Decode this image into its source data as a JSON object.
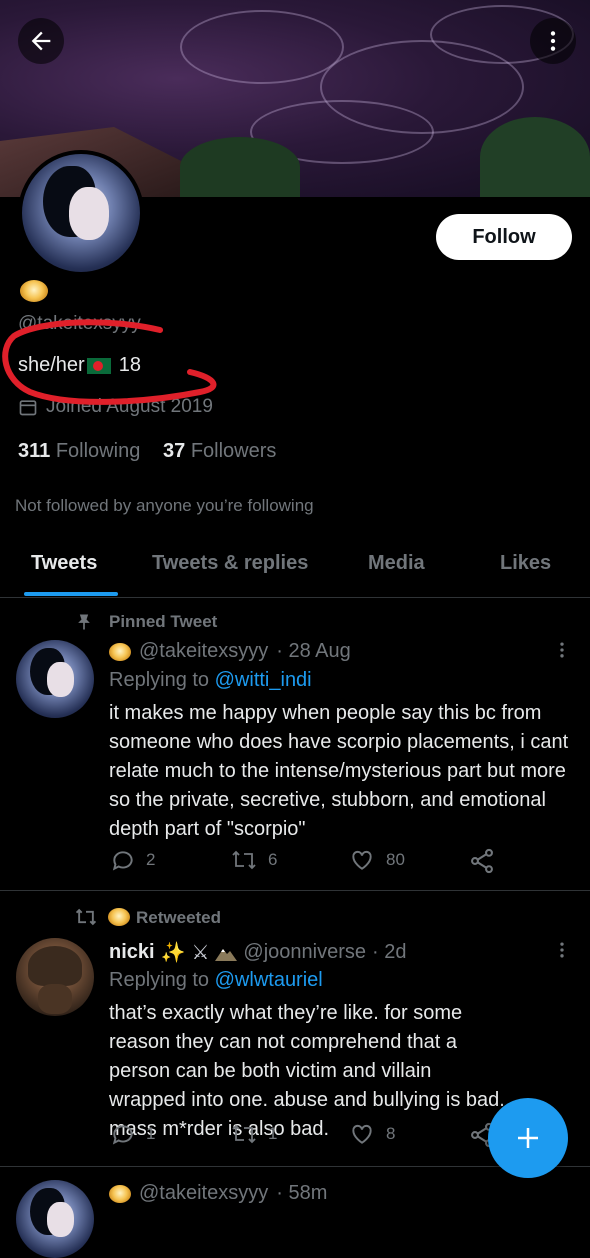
{
  "header": {
    "back_icon": "arrow-left-icon",
    "more_icon": "more-vertical-icon"
  },
  "profile": {
    "handle": "@takeitexsyyy",
    "bio_text": "she/her",
    "bio_age": "18",
    "joined": "Joined August 2019",
    "following_count": "311",
    "following_label": "Following",
    "followers_count": "37",
    "followers_label": "Followers",
    "followed_by_note": "Not followed by anyone you’re following",
    "follow_button": "Follow",
    "highlight_color": "#e0202a"
  },
  "tabs": [
    {
      "label": "Tweets",
      "active": true
    },
    {
      "label": "Tweets & replies"
    },
    {
      "label": "Media"
    },
    {
      "label": "Likes"
    }
  ],
  "tweets": [
    {
      "context": "Pinned Tweet",
      "handle": "@takeitexsyyy",
      "time": "· 28 Aug",
      "replying_prefix": "Replying to",
      "replying_to": "@witti_indi",
      "text": "it makes me happy when people say this bc from someone who does have scorpio placements, i cant relate much to the intense/mysterious part but more so the private, secretive, stubborn, and emotional depth part of \"scorpio\"",
      "replies": "2",
      "retweets": "6",
      "likes": "80"
    },
    {
      "context": "Retweeted",
      "name": "nicki",
      "handle": "@joonniverse",
      "time": "· 2d",
      "replying_prefix": "Replying to",
      "replying_to": "@wlwtauriel",
      "text": "that’s exactly what they’re like. for some reason they can not comprehend that a person can be both victim and villain wrapped into one. abuse and bullying is bad. mass m*rder is also bad.",
      "replies": "1",
      "retweets": "1",
      "likes": "8"
    },
    {
      "handle": "@takeitexsyyy",
      "time": "· 58m"
    }
  ],
  "colors": {
    "accent": "#1d9bf0",
    "muted": "#71767b",
    "bg": "#000000"
  }
}
